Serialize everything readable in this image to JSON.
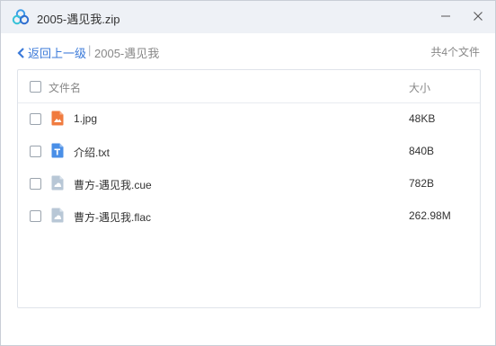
{
  "window": {
    "title": "2005-遇见我.zip"
  },
  "nav": {
    "back_label": "返回上一级",
    "separator": "|",
    "current_folder": "2005-遇见我",
    "file_count": "共4个文件"
  },
  "list": {
    "header": {
      "name": "文件名",
      "size": "大小"
    },
    "files": [
      {
        "name": "1.jpg",
        "size": "48KB",
        "icon": "image-file-icon"
      },
      {
        "name": "介绍.txt",
        "size": "840B",
        "icon": "text-file-icon"
      },
      {
        "name": "曹方-遇见我.cue",
        "size": "782B",
        "icon": "generic-file-icon"
      },
      {
        "name": "曹方-遇见我.flac",
        "size": "262.98M",
        "icon": "generic-file-icon"
      }
    ]
  },
  "colors": {
    "accent": "#3b7ad9",
    "image_icon": "#f07b3f",
    "text_icon": "#4a8fe7",
    "generic_icon": "#b8c7d6"
  }
}
